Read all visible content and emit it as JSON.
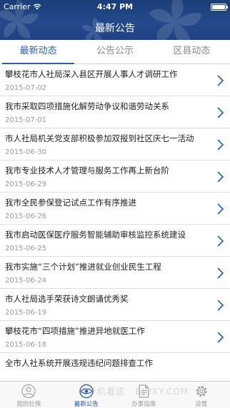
{
  "status_bar": {
    "carrier": "Carrier",
    "time": "4:47 PM"
  },
  "nav": {
    "title": "最新公告"
  },
  "tabs": [
    {
      "label": "最新动态",
      "active": true
    },
    {
      "label": "公告公示",
      "active": false
    },
    {
      "label": "区县动态",
      "active": false
    }
  ],
  "articles": [
    {
      "title": "攀枝花市人社局深入县区开展人事人才调研工作",
      "date": "2015-07-02"
    },
    {
      "title": "我市采取四项措施化解劳动争议和谐劳动关系",
      "date": "2015-07-01"
    },
    {
      "title": "市人社局机关党支部积极参加双报到社区庆七一活动",
      "date": "2015-06-30"
    },
    {
      "title": "我市专业技术人才管理与服务工作再上新台阶",
      "date": "2015-06-29"
    },
    {
      "title": "我市全民参保登记试点工作有序推进",
      "date": "2015-06-26"
    },
    {
      "title": "我市启动医保医疗服务智能辅助审核监控系统建设",
      "date": "2015-06-25"
    },
    {
      "title": "我市实施“三个计划”推进就业创业民生工程",
      "date": "2015-06-24"
    },
    {
      "title": "市人社局选手荣获诗文朗诵优秀奖",
      "date": "2015-06-19"
    },
    {
      "title": "攀枝花市“四项措施”推进异地就医工作",
      "date": "2015-06-18"
    },
    {
      "title": "全市人社系统开展违规违纪问题排查工作",
      "date": ""
    }
  ],
  "tabbar": [
    {
      "label": "我的社保",
      "icon": "person-icon",
      "active": false
    },
    {
      "label": "最新公告",
      "icon": "eye-icon",
      "active": true
    },
    {
      "label": "办事指南",
      "icon": "document-icon",
      "active": false
    },
    {
      "label": "设置",
      "icon": "gear-icon",
      "active": false
    }
  ],
  "watermark": "用手机看这 · BIUXY.COM",
  "colors": {
    "header": "#1f4283",
    "accent": "#2a60b0"
  }
}
